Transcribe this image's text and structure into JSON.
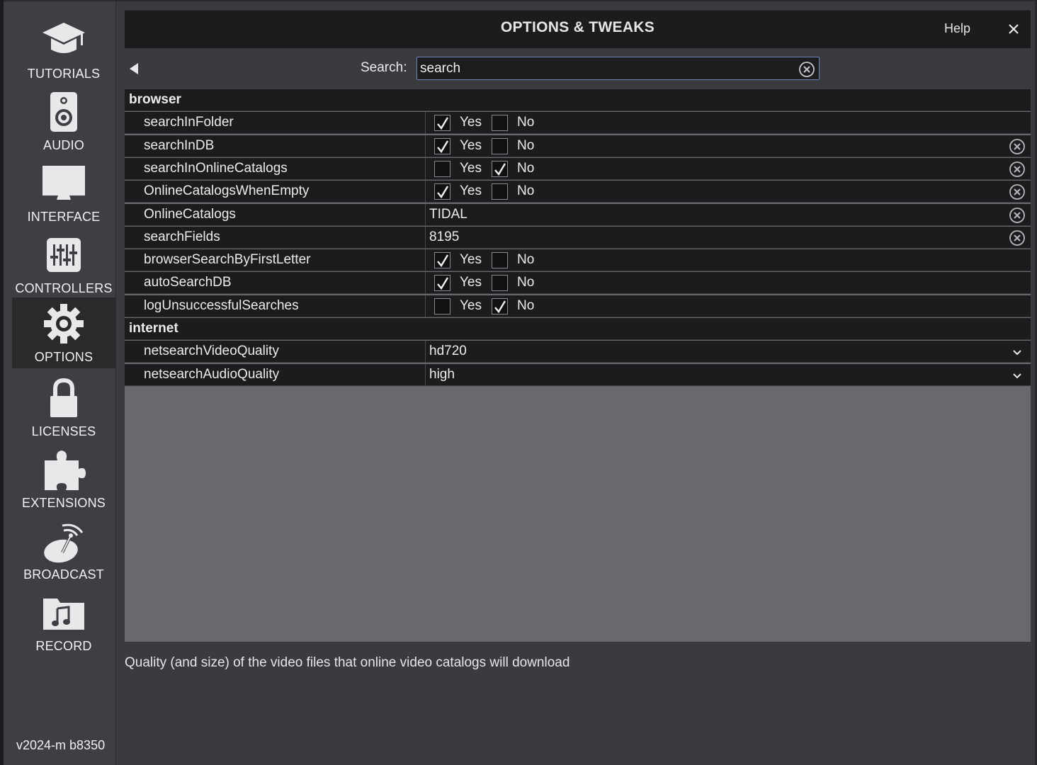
{
  "sidebar": {
    "items": [
      {
        "label": "TUTORIALS",
        "icon": "graduation-cap-icon",
        "active": false
      },
      {
        "label": "AUDIO",
        "icon": "speaker-icon",
        "active": false
      },
      {
        "label": "INTERFACE",
        "icon": "monitor-icon",
        "active": false
      },
      {
        "label": "CONTROLLERS",
        "icon": "sliders-icon",
        "active": false
      },
      {
        "label": "OPTIONS",
        "icon": "gear-icon",
        "active": true
      },
      {
        "label": "LICENSES",
        "icon": "lock-icon",
        "active": false
      },
      {
        "label": "EXTENSIONS",
        "icon": "puzzle-icon",
        "active": false
      },
      {
        "label": "BROADCAST",
        "icon": "satellite-dish-icon",
        "active": false
      },
      {
        "label": "RECORD",
        "icon": "music-folder-icon",
        "active": false
      }
    ],
    "version": "v2024-m b8350"
  },
  "header": {
    "title": "OPTIONS & TWEAKS",
    "help_label": "Help"
  },
  "search": {
    "label": "Search:",
    "value": "search"
  },
  "sections": [
    {
      "title": "browser",
      "settings": [
        {
          "name": "searchInFolder",
          "type": "bool",
          "value": "Yes",
          "resettable": false
        },
        {
          "name": "searchInDB",
          "type": "bool",
          "value": "Yes",
          "resettable": true
        },
        {
          "name": "searchInOnlineCatalogs",
          "type": "bool",
          "value": "No",
          "resettable": true
        },
        {
          "name": "OnlineCatalogsWhenEmpty",
          "type": "bool",
          "value": "Yes",
          "resettable": true
        },
        {
          "name": "OnlineCatalogs",
          "type": "text",
          "value": "TIDAL",
          "resettable": true
        },
        {
          "name": "searchFields",
          "type": "text",
          "value": "8195",
          "resettable": true
        },
        {
          "name": "browserSearchByFirstLetter",
          "type": "bool",
          "value": "Yes",
          "resettable": false
        },
        {
          "name": "autoSearchDB",
          "type": "bool",
          "value": "Yes",
          "resettable": false
        },
        {
          "name": "logUnsuccessfulSearches",
          "type": "bool",
          "value": "No",
          "resettable": false
        }
      ]
    },
    {
      "title": "internet",
      "settings": [
        {
          "name": "netsearchVideoQuality",
          "type": "select",
          "value": "hd720",
          "resettable": false
        },
        {
          "name": "netsearchAudioQuality",
          "type": "select",
          "value": "high",
          "resettable": false
        }
      ]
    }
  ],
  "labels": {
    "yes": "Yes",
    "no": "No"
  },
  "description": "Quality (and size) of the video files that online video catalogs will download"
}
